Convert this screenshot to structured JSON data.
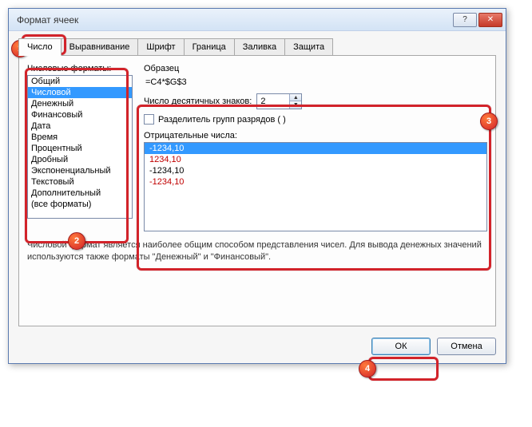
{
  "window": {
    "title": "Формат ячеек"
  },
  "tabs": {
    "items": [
      {
        "label": "Число"
      },
      {
        "label": "Выравнивание"
      },
      {
        "label": "Шрифт"
      },
      {
        "label": "Граница"
      },
      {
        "label": "Заливка"
      },
      {
        "label": "Защита"
      }
    ]
  },
  "categories": {
    "label": "Числовые форматы:",
    "items": [
      "Общий",
      "Числовой",
      "Денежный",
      "Финансовый",
      "Дата",
      "Время",
      "Процентный",
      "Дробный",
      "Экспоненциальный",
      "Текстовый",
      "Дополнительный",
      "(все форматы)"
    ],
    "selected_index": 1
  },
  "sample": {
    "label": "Образец",
    "value": "=C4*$G$3"
  },
  "decimals": {
    "label": "Число десятичных знаков:",
    "value": "2"
  },
  "separator": {
    "label": "Разделитель групп разрядов ( )",
    "checked": false
  },
  "negative": {
    "label": "Отрицательные числа:",
    "items": [
      {
        "text": "-1234,10",
        "red": false
      },
      {
        "text": "1234,10",
        "red": true
      },
      {
        "text": "-1234,10",
        "red": false
      },
      {
        "text": "-1234,10",
        "red": true
      }
    ],
    "selected_index": 0
  },
  "description": "Числовой формат является наиболее общим способом представления чисел. Для вывода денежных значений используются также форматы \"Денежный\" и \"Финансовый\".",
  "buttons": {
    "ok": "ОК",
    "cancel": "Отмена"
  },
  "badges": {
    "b1": "1",
    "b2": "2",
    "b3": "3",
    "b4": "4"
  }
}
